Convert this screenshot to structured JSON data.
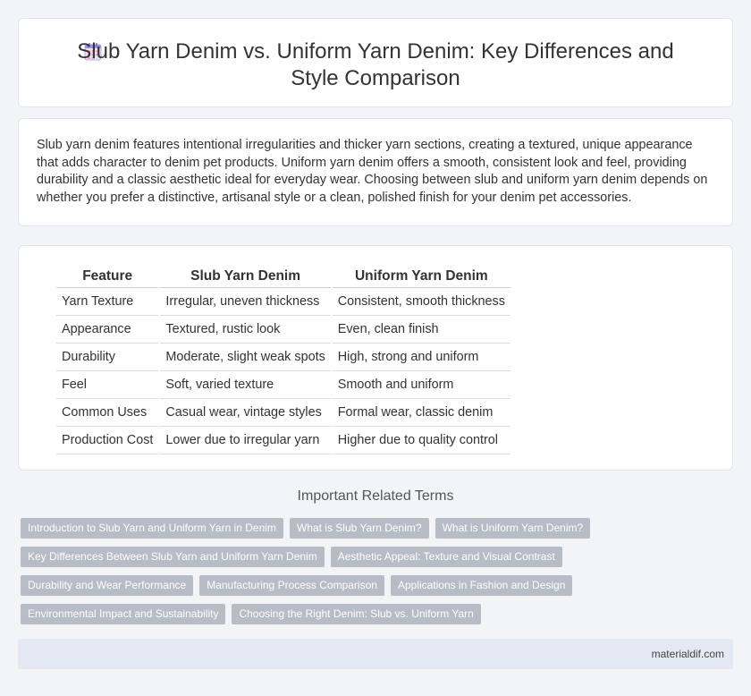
{
  "header": {
    "icon": "calendar-icon",
    "title": "Slub Yarn Denim vs. Uniform Yarn Denim: Key Differences and Style Comparison"
  },
  "intro": {
    "text": "Slub yarn denim features intentional irregularities and thicker yarn sections, creating a textured, unique appearance that adds character to denim pet products. Uniform yarn denim offers a smooth, consistent look and feel, providing durability and a classic aesthetic ideal for everyday wear. Choosing between slub and uniform yarn denim depends on whether you prefer a distinctive, artisanal style or a clean, polished finish for your denim pet accessories."
  },
  "table": {
    "headers": [
      "Feature",
      "Slub Yarn Denim",
      "Uniform Yarn Denim"
    ],
    "rows": [
      [
        "Yarn Texture",
        "Irregular, uneven thickness",
        "Consistent, smooth thickness"
      ],
      [
        "Appearance",
        "Textured, rustic look",
        "Even, clean finish"
      ],
      [
        "Durability",
        "Moderate, slight weak spots",
        "High, strong and uniform"
      ],
      [
        "Feel",
        "Soft, varied texture",
        "Smooth and uniform"
      ],
      [
        "Common Uses",
        "Casual wear, vintage styles",
        "Formal wear, classic denim"
      ],
      [
        "Production Cost",
        "Lower due to irregular yarn",
        "Higher due to quality control"
      ]
    ]
  },
  "related": {
    "title": "Important Related Terms",
    "rows": [
      [
        "Introduction to Slub Yarn and Uniform Yarn in Denim",
        "What is Slub Yarn Denim?",
        "What is Uniform Yarn Denim?"
      ],
      [
        "Key Differences Between Slub Yarn and Uniform Yarn Denim",
        "Aesthetic Appeal: Texture and Visual Contrast"
      ],
      [
        "Durability and Wear Performance",
        "Manufacturing Process Comparison",
        "Applications in Fashion and Design"
      ],
      [
        "Environmental Impact and Sustainability",
        "Choosing the Right Denim: Slub vs. Uniform Yarn"
      ]
    ]
  },
  "footer": {
    "site": "materialdif.com"
  },
  "colors": {
    "page_bg": "#f2f4f8",
    "tag_bg": "#b8bcc4",
    "footer_bg": "#e4e9f4"
  }
}
